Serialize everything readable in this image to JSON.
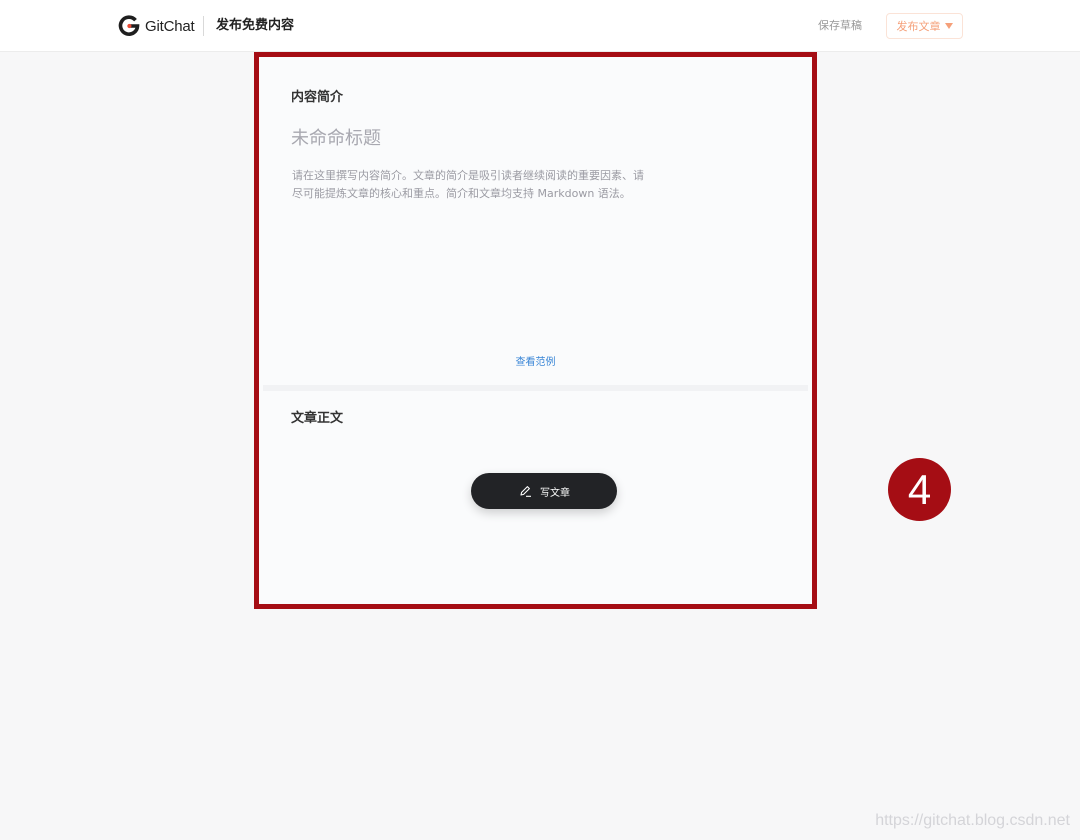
{
  "header": {
    "logo_text": "GitChat",
    "page_title": "发布免费内容",
    "save_draft": "保存草稿",
    "publish": "发布文章"
  },
  "intro_section": {
    "label": "内容简介",
    "title_placeholder": "未命命标题",
    "description_line1": "请在这里撰写内容简介。文章的简介是吸引读者继续阅读的重要因素、请",
    "description_line2": "尽可能提炼文章的核心和重点。简介和文章均支持 Markdown 语法。",
    "example_link": "查看范例"
  },
  "body_section": {
    "label": "文章正文",
    "write_button": "写文章"
  },
  "step_badge": "4",
  "watermark": "https://gitchat.blog.csdn.net",
  "colors": {
    "annotation_red": "#a50d14",
    "publish_accent": "#f5a07a",
    "link_blue": "#3a86d6",
    "dark_button": "#222326"
  },
  "icons": [
    "gitchat-logo-icon",
    "caret-down-icon",
    "pen-icon"
  ]
}
